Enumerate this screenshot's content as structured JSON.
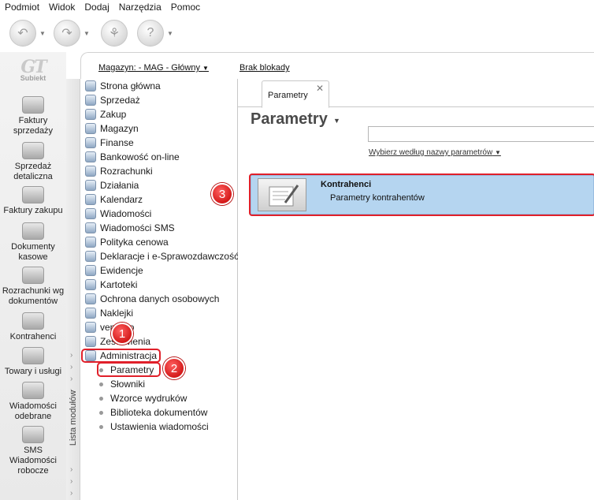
{
  "menu": [
    "Podmiot",
    "Widok",
    "Dodaj",
    "Narzędzia",
    "Pomoc"
  ],
  "toolbar": {
    "buttons": [
      "back-icon",
      "forward-icon",
      "pin-icon",
      "help-icon"
    ]
  },
  "logo": {
    "mark": "GT",
    "label": "Subiekt"
  },
  "left_bar": [
    {
      "label": "Faktury sprzedaży",
      "icon": "invoice-stack-icon"
    },
    {
      "label": "Sprzedaż detaliczna",
      "icon": "cash-register-icon"
    },
    {
      "label": "Faktury zakupu",
      "icon": "purchase-invoice-icon"
    },
    {
      "label": "Dokumenty kasowe",
      "icon": "cash-document-icon"
    },
    {
      "label": "Rozrachunki wg dokumentów",
      "icon": "settlements-icon"
    },
    {
      "label": "Kontrahenci",
      "icon": "contractor-icon"
    },
    {
      "label": "Towary i usługi",
      "icon": "goods-icon"
    },
    {
      "label": "Wiadomości odebrane",
      "icon": "received-messages-icon"
    },
    {
      "label": "SMS Wiadomości robocze",
      "icon": "sms-draft-icon"
    }
  ],
  "header": {
    "warehouse": "Magazyn: - MAG - Główny",
    "lock": "Brak blokady"
  },
  "module_list_label": "Lista modułów",
  "tree": [
    {
      "label": "Strona główna",
      "icon": "home-page-icon"
    },
    {
      "label": "Sprzedaż",
      "icon": "sales-icon"
    },
    {
      "label": "Zakup",
      "icon": "purchase-icon"
    },
    {
      "label": "Magazyn",
      "icon": "warehouse-icon"
    },
    {
      "label": "Finanse",
      "icon": "finance-icon"
    },
    {
      "label": "Bankowość on-line",
      "icon": "online-banking-icon"
    },
    {
      "label": "Rozrachunki",
      "icon": "settlements-icon"
    },
    {
      "label": "Działania",
      "icon": "actions-icon"
    },
    {
      "label": "Kalendarz",
      "icon": "calendar-icon"
    },
    {
      "label": "Wiadomości",
      "icon": "messages-icon"
    },
    {
      "label": "Wiadomości SMS",
      "icon": "sms-icon"
    },
    {
      "label": "Polityka cenowa",
      "icon": "price-policy-icon"
    },
    {
      "label": "Deklaracje i e-Sprawozdawczość",
      "icon": "declarations-icon"
    },
    {
      "label": "Ewidencje",
      "icon": "records-icon"
    },
    {
      "label": "Kartoteki",
      "icon": "card-index-icon"
    },
    {
      "label": "Ochrona danych osobowych",
      "icon": "data-protection-icon"
    },
    {
      "label": "Naklejki",
      "icon": "stickers-icon"
    },
    {
      "label": "vendero",
      "icon": "vendero-icon"
    },
    {
      "label": "Zestawienia",
      "icon": "reports-icon"
    },
    {
      "label": "Administracja",
      "icon": "administration-icon"
    }
  ],
  "tree_sub": [
    "Parametry",
    "Słowniki",
    "Wzorce wydruków",
    "Biblioteka dokumentów",
    "Ustawienia wiadomości"
  ],
  "badges": [
    "1",
    "2",
    "3"
  ],
  "panel": {
    "tab_label": "Parametry",
    "title": "Parametry",
    "search_value": "",
    "hint": "Wybierz według nazwy parametrów",
    "card_title": "Kontrahenci",
    "card_subtitle": "Parametry kontrahentów"
  },
  "colors": {
    "selection_bg": "#b5d5f0",
    "highlight_red": "#e0202a"
  }
}
